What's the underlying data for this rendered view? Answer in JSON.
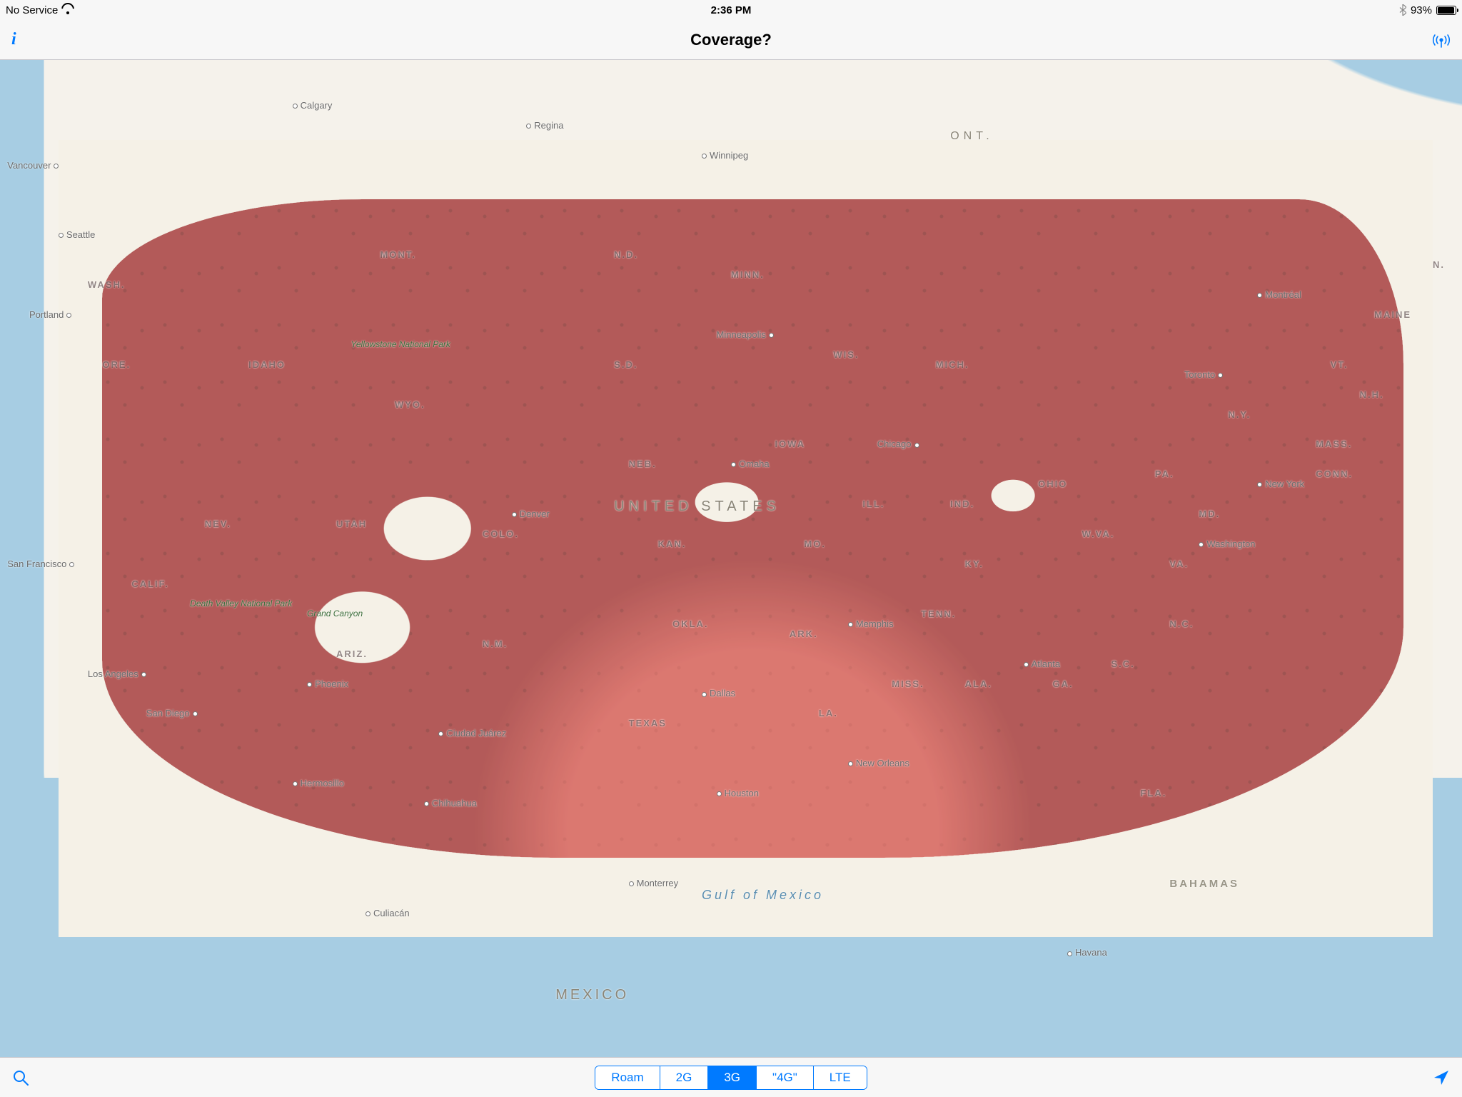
{
  "status_bar": {
    "carrier": "No Service",
    "time": "2:36 PM",
    "battery_pct": "93%"
  },
  "nav": {
    "title": "Coverage?"
  },
  "networks": {
    "options": [
      "Roam",
      "2G",
      "3G",
      "\"4G\"",
      "LTE"
    ],
    "selected_index": 2
  },
  "map_labels": {
    "countries": {
      "us": "UNITED STATES",
      "mexico": "MEXICO",
      "ont": "ONT.",
      "bahamas": "BAHAMAS"
    },
    "water": {
      "gulf": "Gulf of Mexico"
    },
    "parks": {
      "yellowstone": "Yellowstone National Park",
      "death_valley": "Death Valley National Park",
      "grand_canyon": "Grand Canyon"
    },
    "cities": {
      "vancouver": "Vancouver",
      "calgary": "Calgary",
      "regina": "Regina",
      "winnipeg": "Winnipeg",
      "seattle": "Seattle",
      "portland": "Portland",
      "san_francisco": "San Francisco",
      "los_angeles": "Los Angeles",
      "san_diego": "San Diego",
      "phoenix": "Phoenix",
      "denver": "Denver",
      "minneapolis": "Minneapolis",
      "omaha": "Omaha",
      "chicago": "Chicago",
      "toronto": "Toronto",
      "montreal": "Montréal",
      "new_york": "New York",
      "washington": "Washington",
      "atlanta": "Atlanta",
      "memphis": "Memphis",
      "new_orleans": "New Orleans",
      "dallas": "Dallas",
      "houston": "Houston",
      "monterrey": "Monterrey",
      "chihuahua": "Chihuahua",
      "hermosillo": "Hermosillo",
      "culiacan": "Culiacán",
      "ciudad_juarez": "Ciudad Juárez",
      "havana": "Havana"
    },
    "states": {
      "wash": "WASH.",
      "ore": "ORE.",
      "idaho": "IDAHO",
      "mont": "MONT.",
      "nd": "N.D.",
      "sd": "S.D.",
      "minn": "MINN.",
      "wis": "WIS.",
      "mich": "MICH.",
      "wyo": "WYO.",
      "neb": "NEB.",
      "iowa": "IOWA",
      "ill": "ILL.",
      "ind": "IND.",
      "ohio": "OHIO",
      "pa": "PA.",
      "ny": "N.Y.",
      "mass": "MASS.",
      "conn": "CONN.",
      "vt": "VT.",
      "nh": "N.H.",
      "maine": "MAINE",
      "n": "N.",
      "nev": "NEV.",
      "utah": "UTAH",
      "colo": "COLO.",
      "kan": "KAN.",
      "mo": "MO.",
      "ky": "KY.",
      "wva": "W.VA.",
      "va": "VA.",
      "md": "MD.",
      "calif": "CALIF.",
      "ariz": "ARIZ.",
      "nm": "N.M.",
      "okla": "OKLA.",
      "ark": "ARK.",
      "tenn": "TENN.",
      "nc": "N.C.",
      "sc": "S.C.",
      "texas": "TEXAS",
      "la": "LA.",
      "miss": "MISS.",
      "ala": "ALA.",
      "ga": "GA.",
      "fla": "FLA."
    }
  }
}
